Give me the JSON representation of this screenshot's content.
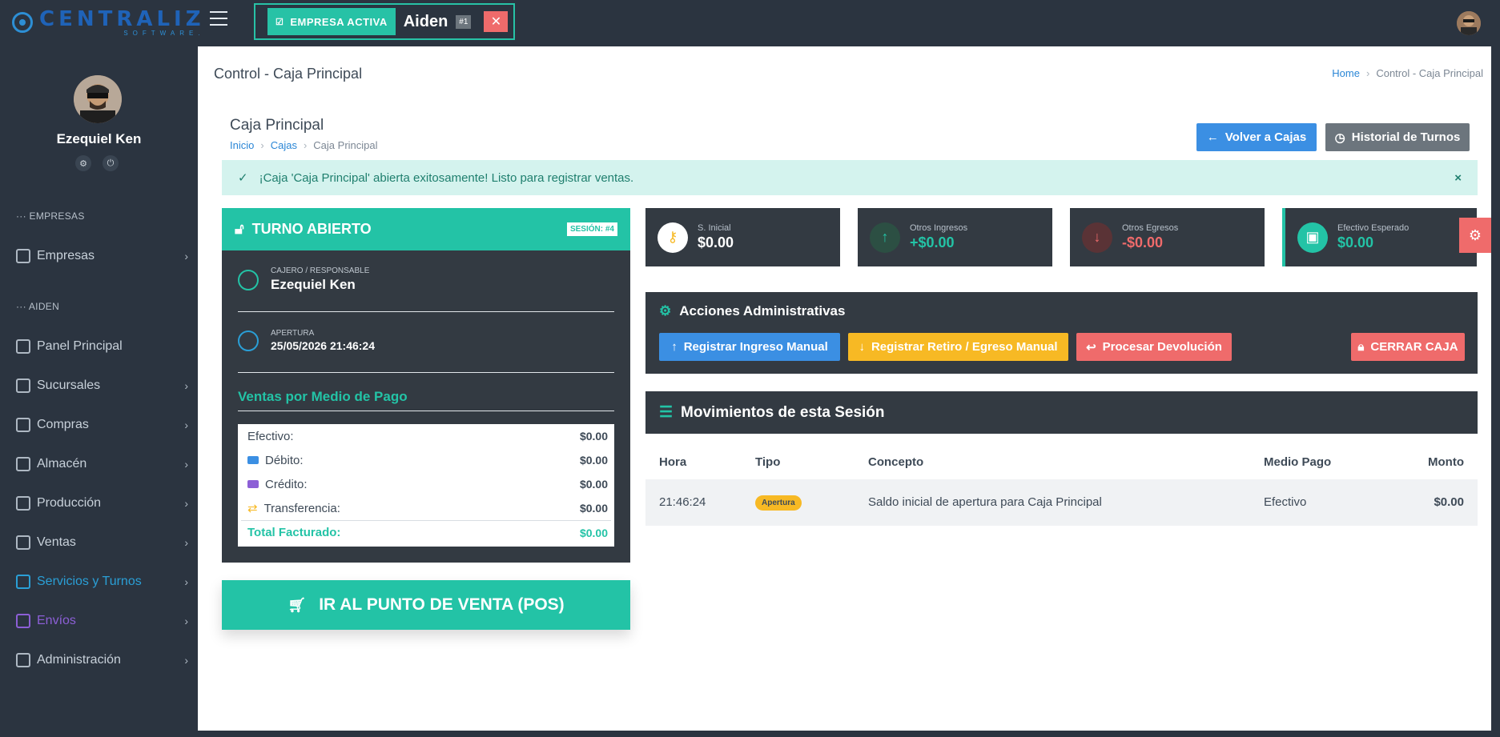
{
  "app": {
    "logo_main": "CENTRALIZ",
    "logo_sub": "SOFTWARE.",
    "active_company_badge": "EMPRESA ACTIVA",
    "active_company_name": "Aiden",
    "active_company_num": "#1",
    "close_glyph": "✕"
  },
  "sidebar": {
    "user_name": "Ezequiel Ken",
    "section_empresas": "EMPRESAS",
    "section_aiden": "AIDEN",
    "items": [
      {
        "label": "Empresas"
      },
      {
        "label": "Panel Principal"
      },
      {
        "label": "Sucursales"
      },
      {
        "label": "Compras"
      },
      {
        "label": "Almacén"
      },
      {
        "label": "Producción"
      },
      {
        "label": "Ventas"
      },
      {
        "label": "Servicios y Turnos"
      },
      {
        "label": "Envíos"
      },
      {
        "label": "Administración"
      }
    ]
  },
  "header": {
    "page_title": "Control - Caja Principal",
    "breadcrumb_home": "Home",
    "breadcrumb_current": "Control - Caja Principal"
  },
  "card": {
    "title": "Caja Principal",
    "bc_inicio": "Inicio",
    "bc_cajas": "Cajas",
    "bc_current": "Caja Principal",
    "btn_volver": "Volver a Cajas",
    "btn_historial": "Historial de Turnos"
  },
  "alert": {
    "text": "¡Caja 'Caja Principal' abierta exitosamente! Listo para registrar ventas.",
    "close": "×"
  },
  "turno": {
    "title": "TURNO ABIERTO",
    "sesion": "SESIÓN: #4",
    "cajero_label": "CAJERO / RESPONSABLE",
    "cajero_name": "Ezequiel Ken",
    "apertura_label": "APERTURA",
    "apertura_date": "25/05/2026 21:46:24",
    "ventas_title": "Ventas por Medio de Pago",
    "ventas": [
      {
        "label": "Efectivo:",
        "value": "$0.00"
      },
      {
        "label": "Débito:",
        "value": "$0.00"
      },
      {
        "label": "Crédito:",
        "value": "$0.00"
      },
      {
        "label": "Transferencia:",
        "value": "$0.00"
      }
    ],
    "total_label": "Total Facturado:",
    "total_value": "$0.00",
    "btn_pos": "IR AL PUNTO DE VENTA (POS)"
  },
  "stats": [
    {
      "label": "S. Inicial",
      "value": "$0.00"
    },
    {
      "label": "Otros Ingresos",
      "value": "+$0.00"
    },
    {
      "label": "Otros Egresos",
      "value": "-$0.00"
    },
    {
      "label": "Efectivo Esperado",
      "value": "$0.00"
    }
  ],
  "acciones": {
    "title": "Acciones Administrativas",
    "btn_ingreso": "Registrar Ingreso Manual",
    "btn_retiro": "Registrar Retiro / Egreso Manual",
    "btn_devolucion": "Procesar Devolución",
    "btn_cerrar": "CERRAR CAJA"
  },
  "movimientos": {
    "title": "Movimientos de esta Sesión",
    "columns": [
      "Hora",
      "Tipo",
      "Concepto",
      "Medio Pago",
      "Monto"
    ],
    "rows": [
      {
        "hora": "21:46:24",
        "tipo": "Apertura",
        "concepto": "Saldo inicial de apertura para Caja Principal",
        "medio": "Efectivo",
        "monto": "$0.00"
      }
    ]
  }
}
